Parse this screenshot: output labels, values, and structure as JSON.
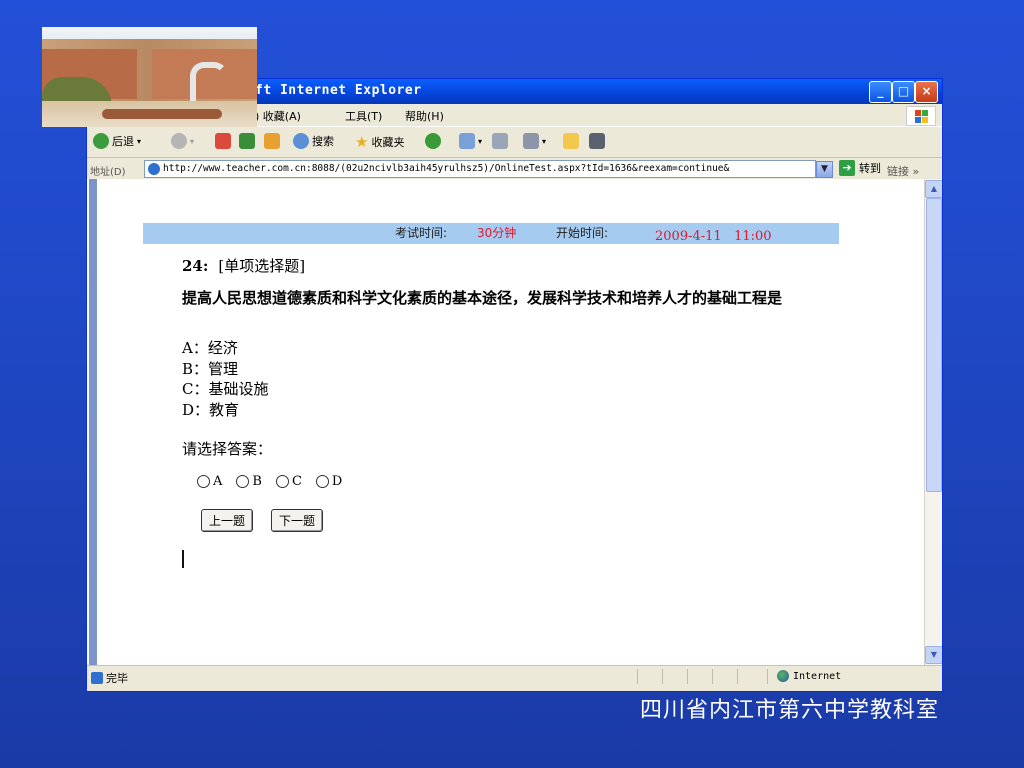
{
  "browser": {
    "title": "ft Internet Explorer",
    "menu": [
      ") 收藏(A)",
      "工具(T)",
      "帮助(H)"
    ],
    "toolbar": {
      "back": "后退",
      "search": "搜索",
      "favorites": "收藏夹"
    },
    "address": {
      "label": "地址(D)",
      "url": "http://www.teacher.com.cn:8088/(02u2ncivlb3aih45yrulhsz5)/OnlineTest.aspx?tId=1636&reexam=continue&",
      "go": "转到",
      "links": "链接 »"
    },
    "status": {
      "text": "完毕",
      "zone": "Internet"
    },
    "colors": {
      "titlebar": "#0543d8",
      "chrome": "#ece9d8",
      "exam_bar": "#a6cbf1",
      "accent_red": "#e0182a"
    }
  },
  "exam": {
    "time_label": "考试时间:",
    "time_value": "30分钟",
    "start_label": "开始时间:",
    "start_value": "2009-4-11   11:00",
    "number": "24:",
    "type": "[单项选择题]",
    "question": "提高人民思想道德素质和科学文化素质的基本途径，发展科学技术和培养人才的基础工程是",
    "options": [
      "A：经济",
      "B：管理",
      "C：基础设施",
      "D：教育"
    ],
    "prompt": "请选择答案：",
    "radios": [
      "A",
      "B",
      "C",
      "D"
    ],
    "prev_button": "上一题",
    "next_button": "下一题"
  },
  "slide": {
    "footer": "四川省内江市第六中学教科室"
  }
}
